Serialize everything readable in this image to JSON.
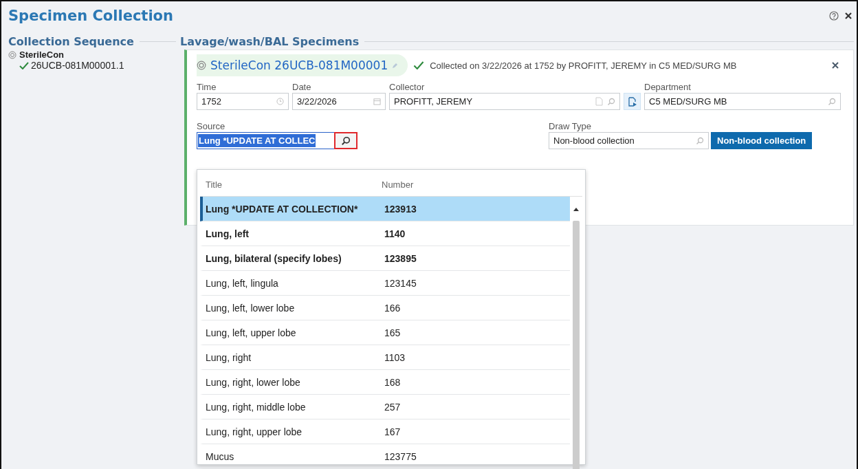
{
  "window": {
    "title": "Specimen Collection"
  },
  "sequence": {
    "heading": "Collection Sequence",
    "items": [
      {
        "name": "SterileCon",
        "children": [
          {
            "name": "26UCB-081M00001.1",
            "collected": true
          }
        ]
      }
    ]
  },
  "section": {
    "heading": "Lavage/wash/BAL Specimens"
  },
  "specimen": {
    "title": "SterileCon 26UCB-081M00001",
    "status": "Collected on 3/22/2026 at 1752 by PROFITT, JEREMY in C5 MED/SURG MB",
    "collected": true,
    "fields": {
      "time": {
        "label": "Time",
        "value": "1752"
      },
      "date": {
        "label": "Date",
        "value": "3/22/2026"
      },
      "collector": {
        "label": "Collector",
        "value": "PROFITT, JEREMY"
      },
      "department": {
        "label": "Department",
        "value": "C5 MED/SURG MB"
      },
      "source": {
        "label": "Source",
        "value": "Lung *UPDATE AT COLLEC"
      },
      "draw_type": {
        "label": "Draw Type",
        "value": "Non-blood collection",
        "button": "Non-blood collection"
      }
    }
  },
  "dropdown": {
    "columns": [
      "Title",
      "Number"
    ],
    "rows": [
      {
        "title": "Lung *UPDATE AT COLLECTION*",
        "number": "123913",
        "bold": true,
        "selected": true
      },
      {
        "title": "Lung, left",
        "number": "1140",
        "bold": true,
        "selected": false
      },
      {
        "title": "Lung, bilateral (specify lobes)",
        "number": "123895",
        "bold": true,
        "selected": false
      },
      {
        "title": "Lung, left, lingula",
        "number": "123145",
        "bold": false,
        "selected": false
      },
      {
        "title": "Lung, left, lower lobe",
        "number": "166",
        "bold": false,
        "selected": false
      },
      {
        "title": "Lung, left, upper lobe",
        "number": "165",
        "bold": false,
        "selected": false
      },
      {
        "title": "Lung, right",
        "number": "1103",
        "bold": false,
        "selected": false
      },
      {
        "title": "Lung, right, lower lobe",
        "number": "168",
        "bold": false,
        "selected": false
      },
      {
        "title": "Lung, right, middle lobe",
        "number": "257",
        "bold": false,
        "selected": false
      },
      {
        "title": "Lung, right, upper lobe",
        "number": "167",
        "bold": false,
        "selected": false
      },
      {
        "title": "Mucus",
        "number": "123775",
        "bold": false,
        "selected": false
      }
    ]
  }
}
